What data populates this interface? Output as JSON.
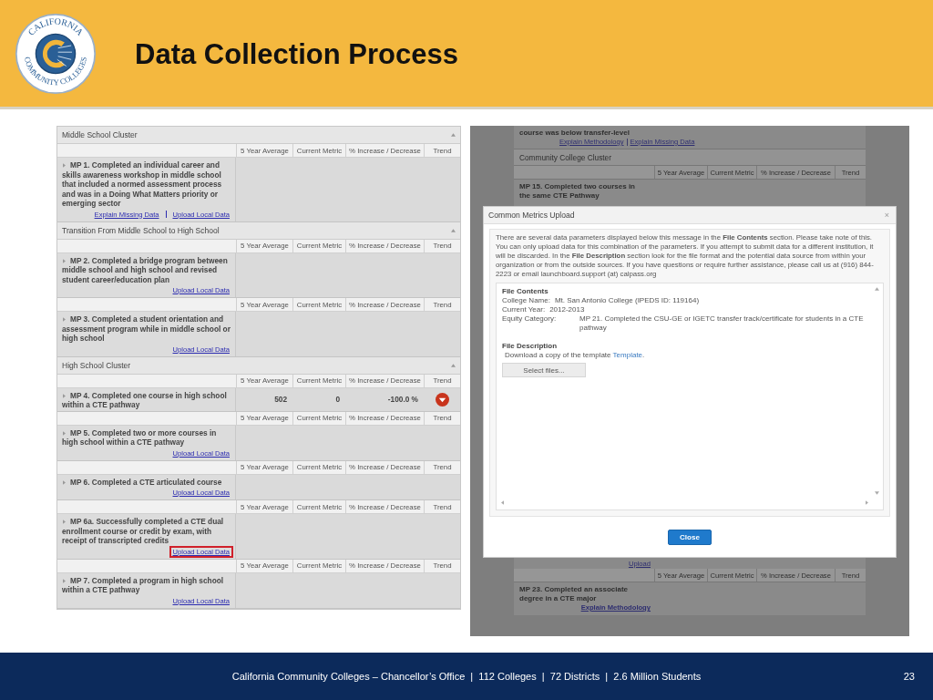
{
  "header": {
    "logo": {
      "top_text": "CALIFORNIA",
      "bottom_text": "COMMUNITY COLLEGES"
    },
    "title": "Data Collection Process"
  },
  "left_screenshot": {
    "sections": [
      {
        "title": "Middle School Cluster",
        "metrics": [
          {
            "columns": [
              "5 Year Average",
              "Current Metric",
              "% Increase / Decrease",
              "Trend"
            ],
            "text": "MP 1. Completed an individual career and skills awareness workshop in middle school that included a normed assessment process and was in a Doing What Matters priority or emerging sector",
            "links": [
              {
                "label": "Explain Missing Data",
                "highlighted": false
              },
              {
                "label": "Upload Local Data",
                "highlighted": false
              }
            ]
          }
        ]
      },
      {
        "title": "Transition From Middle School to High School",
        "metrics": [
          {
            "columns": [
              "5 Year Average",
              "Current Metric",
              "% Increase / Decrease",
              "Trend"
            ],
            "text": "MP 2. Completed a bridge program between middle school and high school and revised student career/education plan",
            "links": [
              {
                "label": "Upload Local Data",
                "highlighted": false
              }
            ]
          },
          {
            "columns": [
              "5 Year Average",
              "Current Metric",
              "% Increase / Decrease",
              "Trend"
            ],
            "text": "MP 3. Completed a student orientation and assessment program while in middle school or high school",
            "links": [
              {
                "label": "Upload Local Data",
                "highlighted": false
              }
            ]
          }
        ]
      },
      {
        "title": "High School Cluster",
        "metrics": [
          {
            "columns": [
              "5 Year Average",
              "Current Metric",
              "% Increase / Decrease",
              "Trend"
            ],
            "text": "MP 4. Completed one course in high school within a CTE pathway",
            "values": [
              "502",
              "0",
              "-100.0 %"
            ],
            "trend_down": true
          },
          {
            "columns": [
              "5 Year Average",
              "Current Metric",
              "% Increase / Decrease",
              "Trend"
            ],
            "text": "MP 5. Completed two or more courses in high school within a CTE pathway",
            "links": [
              {
                "label": "Upload Local Data",
                "highlighted": false
              }
            ]
          },
          {
            "columns": [
              "5 Year Average",
              "Current Metric",
              "% Increase / Decrease",
              "Trend"
            ],
            "text": "MP 6. Completed a CTE articulated course",
            "links": [
              {
                "label": "Upload Local Data",
                "highlighted": false
              }
            ]
          },
          {
            "columns": [
              "5 Year Average",
              "Current Metric",
              "% Increase / Decrease",
              "Trend"
            ],
            "text": "MP 6a. Successfully completed a CTE dual enrollment course or credit by exam, with receipt of transcripted credits",
            "links": [
              {
                "label": "Upload Local Data",
                "highlighted": true
              }
            ]
          },
          {
            "columns": [
              "5 Year Average",
              "Current Metric",
              "% Increase / Decrease",
              "Trend"
            ],
            "text": "MP 7. Completed a program in high school within a CTE pathway",
            "links": [
              {
                "label": "Upload Local Data",
                "highlighted": false
              }
            ]
          }
        ]
      }
    ]
  },
  "right_screenshot": {
    "background": {
      "top_text": "course was below transfer-level",
      "top_links": [
        "Explain Methodology",
        "Explain Missing Data"
      ],
      "section_title": "Community College Cluster",
      "columns": [
        "5 Year Average",
        "Current Metric",
        "% Increase / Decrease",
        "Trend"
      ],
      "metric_top": "MP 15. Completed two courses in the same CTE Pathway",
      "partial_link": "Upload",
      "columns_2": [
        "5 Year Average",
        "Current Metric",
        "% Increase / Decrease",
        "Trend"
      ],
      "metric_bottom": "MP 23. Completed an associate degree in a CTE major",
      "metric_bottom_link": "Explain Methodology"
    },
    "modal": {
      "title": "Common Metrics Upload",
      "close": "×",
      "intro": "There are several data parameters displayed below this message in the **File Contents** section. Please take note of this. You can only upload data for this combination of the parameters. If you attempt to submit data for a different institution, it will be discarded. In the **File Description** section look for the file format and the potential data source from within your organization or from the outside sources. If you have questions or require further assistance, please call us at (916) 844-2223 or email launchboard.support (at) calpass.org",
      "file_contents_heading": "File Contents",
      "fields": [
        {
          "label": "College Name:",
          "value": "Mt. San Antonio College (IPEDS ID: 119164)"
        },
        {
          "label": "Current Year:",
          "value": "2012-2013"
        },
        {
          "label": "Equity Category:",
          "value": "MP 21. Completed the CSU-GE or IGETC transfer track/certificate for students in a CTE pathway"
        }
      ],
      "file_description_heading": "File Description",
      "download_text": "Download a copy of the template",
      "template_link": "Template",
      "download_end": ".",
      "select_button": "Select files...",
      "close_button": "Close"
    }
  },
  "footer": {
    "text": "California Community Colleges – Chancellor’s Office  |  112 Colleges  |  72 Districts  |  2.6 Million Students",
    "page": "23"
  }
}
